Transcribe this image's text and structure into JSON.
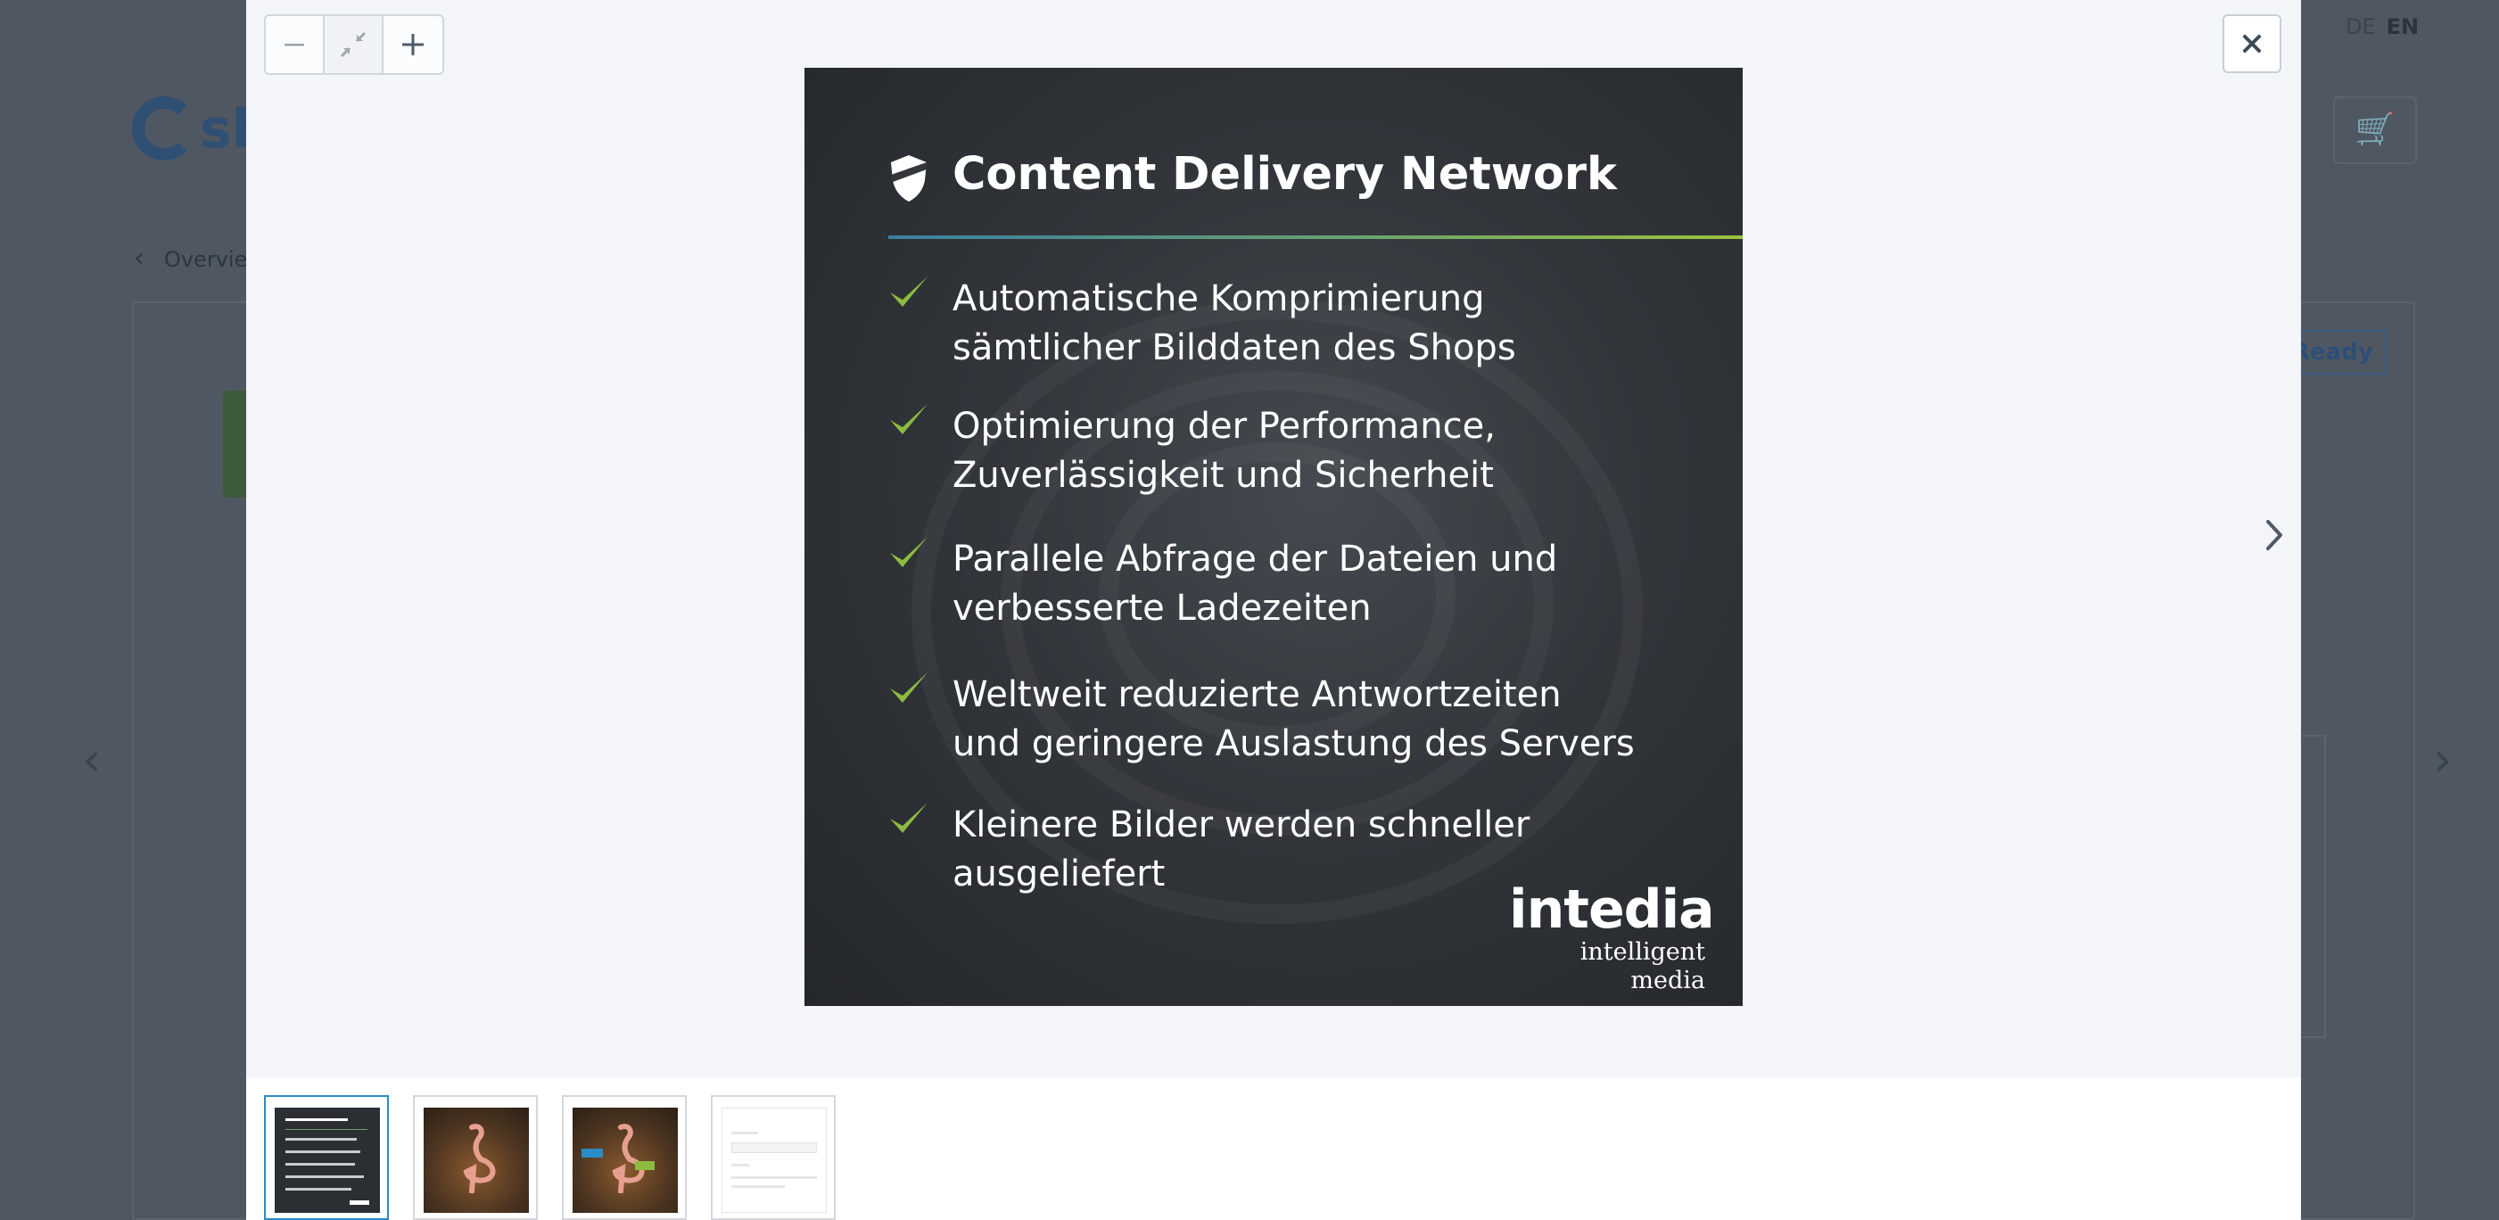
{
  "background_page": {
    "logo_text": "sh",
    "back_link": "Overvie",
    "lang_de": "DE",
    "lang_en": "EN",
    "badge_ready": "Ready"
  },
  "lightbox": {
    "zoom_out_icon": "minus-icon",
    "reset_zoom_icon": "compress-icon",
    "zoom_in_icon": "plus-icon",
    "close_icon": "close-icon",
    "next_icon": "chevron-right-icon",
    "slide": {
      "title": "Content Delivery Network",
      "features": [
        {
          "line1": "Automatische Komprimierung",
          "line2": "sämtlicher Bilddaten des Shops"
        },
        {
          "line1": "Optimierung der Performance,",
          "line2": "Zuverlässigkeit und Sicherheit"
        },
        {
          "line1": "Parallele Abfrage der Dateien und",
          "line2": "verbesserte Ladezeiten"
        },
        {
          "line1": "Weltweit reduzierte Antwortzeiten",
          "line2": "und geringere Auslastung des Servers"
        },
        {
          "line1": "Kleinere Bilder werden schneller",
          "line2": "ausgeliefert"
        }
      ],
      "brand_name": "intedia",
      "brand_tagline": "intelligent media"
    },
    "colors": {
      "check_green": "#8dbb3f",
      "active_thumb_border": "#2a8bc6",
      "modal_bg": "#f3f5f8"
    }
  }
}
